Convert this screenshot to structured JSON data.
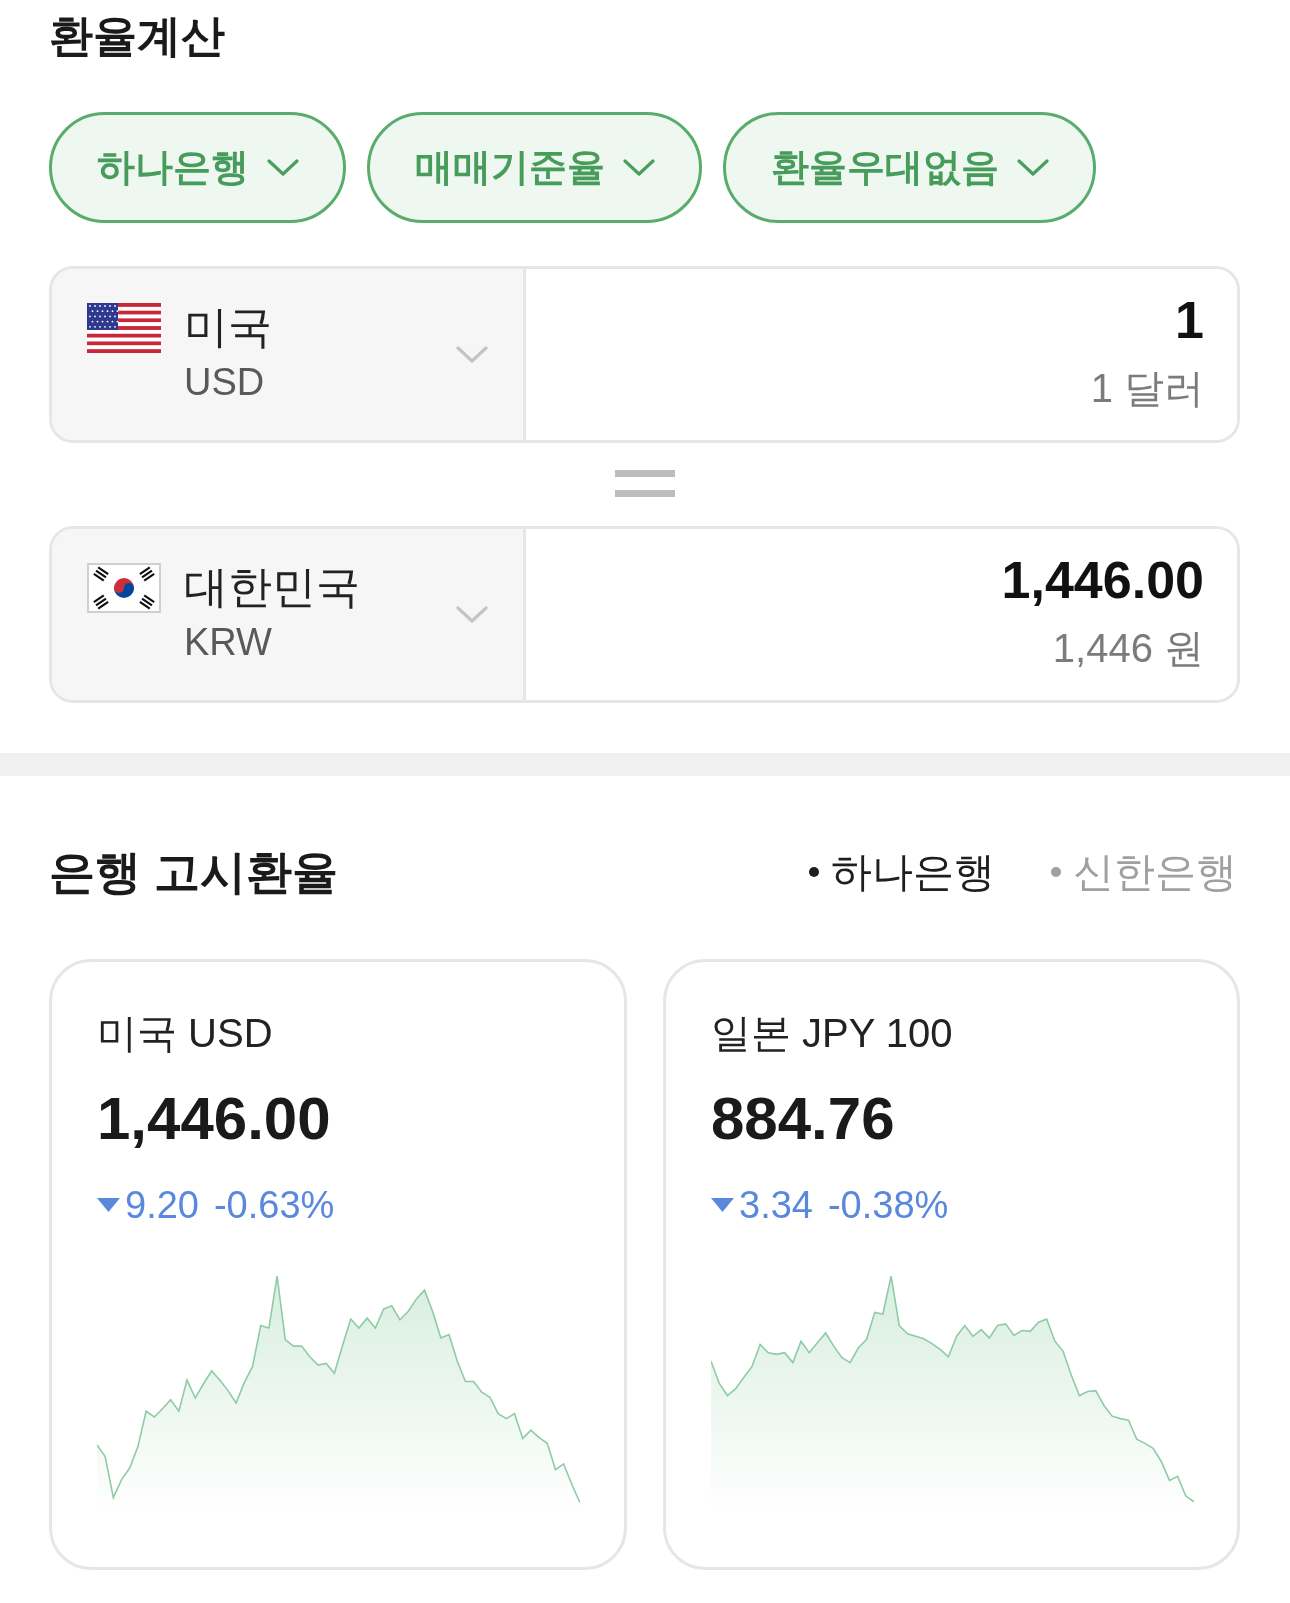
{
  "title": "환율계산",
  "filters": [
    {
      "label": "하나은행"
    },
    {
      "label": "매매기준율"
    },
    {
      "label": "환율우대없음"
    }
  ],
  "converter": {
    "rows": [
      {
        "kind": "us",
        "country": "미국",
        "code": "USD",
        "amount": "1",
        "amount_words": "1 달러"
      },
      {
        "kind": "kr",
        "country": "대한민국",
        "code": "KRW",
        "amount": "1,446.00",
        "amount_words": "1,446 원"
      }
    ]
  },
  "bank_rates": {
    "title": "은행 고시환율",
    "banks": [
      {
        "label": "하나은행",
        "selected": true
      },
      {
        "label": "신한은행",
        "selected": false
      }
    ],
    "cards": [
      {
        "kind": "down",
        "title": "미국 USD",
        "rate": "1,446.00",
        "change": "9.20",
        "change_percent": "-0.63%"
      },
      {
        "kind": "down",
        "title": "일본 JPY 100",
        "rate": "884.76",
        "change": "3.34",
        "change_percent": "-0.38%"
      }
    ]
  }
}
